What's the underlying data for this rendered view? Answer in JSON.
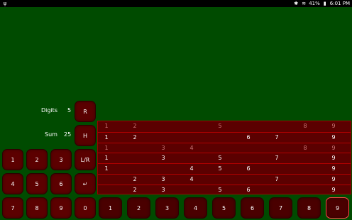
{
  "status": {
    "left_icon": "usb-icon",
    "battery": "41%",
    "time": "6:01 PM"
  },
  "labels": {
    "digits_label": "Digits",
    "digits_value": "5",
    "sum_label": "Sum",
    "sum_value": "25"
  },
  "buttons": {
    "r": "R",
    "h": "H",
    "lr": "L/R",
    "enter": "↵",
    "numpad": [
      [
        "1",
        "2",
        "3"
      ],
      [
        "4",
        "5",
        "6"
      ],
      [
        "7",
        "8",
        "9"
      ]
    ],
    "zero": "0",
    "bottom_digits": [
      "1",
      "2",
      "3",
      "4",
      "5",
      "6",
      "7",
      "8",
      "9"
    ]
  },
  "grid_rows": [
    {
      "style": "dim",
      "cells": [
        "1",
        "2",
        "",
        "",
        "5",
        "",
        "",
        "8",
        "9"
      ]
    },
    {
      "style": "normal",
      "cells": [
        "1",
        "2",
        "",
        "",
        "",
        "6",
        "7",
        "",
        "9"
      ]
    },
    {
      "style": "dim",
      "cells": [
        "1",
        "",
        "3",
        "4",
        "",
        "",
        "",
        "8",
        "9"
      ]
    },
    {
      "style": "normal",
      "cells": [
        "1",
        "",
        "3",
        "",
        "5",
        "",
        "7",
        "",
        "9"
      ]
    },
    {
      "style": "normal",
      "cells": [
        "1",
        "",
        "",
        "4",
        "5",
        "6",
        "",
        "",
        "9"
      ]
    },
    {
      "style": "normal",
      "cells": [
        "",
        "2",
        "3",
        "4",
        "",
        "",
        "7",
        "",
        "9"
      ]
    },
    {
      "style": "normal",
      "cells": [
        "",
        "2",
        "3",
        "",
        "5",
        "6",
        "",
        "",
        "9"
      ]
    }
  ]
}
